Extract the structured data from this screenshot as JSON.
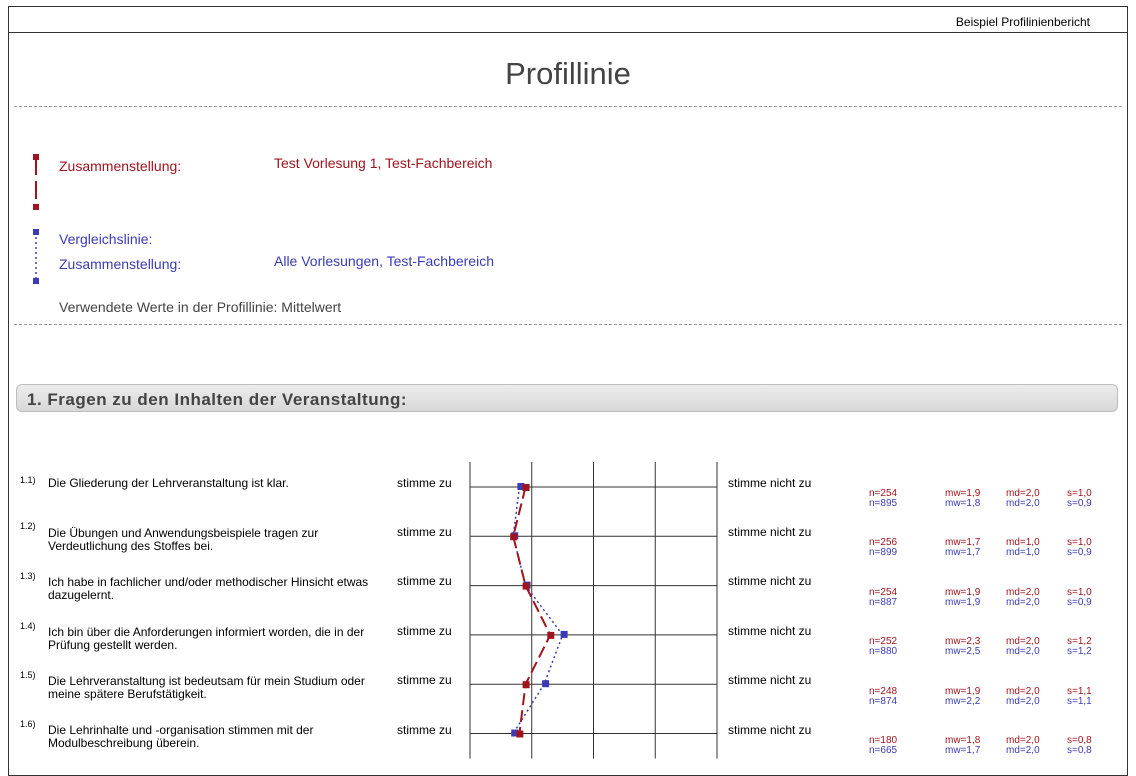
{
  "header": {
    "report_name": "Beispiel Profilinienbericht",
    "title": "Profillinie"
  },
  "legend": {
    "main_label": "Zusammenstellung:",
    "main_value": "Test Vorlesung 1, Test-Fachbereich",
    "compare_heading": "Vergleichslinie:",
    "compare_label": "Zusammenstellung:",
    "compare_value": "Alle Vorlesungen, Test-Fachbereich",
    "note": "Verwendete Werte in der Profillinie: Mittelwert"
  },
  "colors": {
    "main": "#a0141e",
    "compare": "#3b3bb4"
  },
  "section": {
    "title": "1. Fragen zu den Inhalten der Veranstaltung:"
  },
  "questions": [
    {
      "num": "1.1)",
      "text": "Die Gliederung der Lehrveranstaltung ist klar.",
      "left": "stimme zu",
      "right": "stimme nicht zu",
      "main": {
        "n": "n=254",
        "mw": "mw=1,9",
        "md": "md=2,0",
        "s": "s=1,0"
      },
      "compare": {
        "n": "n=895",
        "mw": "mw=1,8",
        "md": "md=2,0",
        "s": "s=0,9"
      }
    },
    {
      "num": "1.2)",
      "text": "Die Übungen und Anwendungsbeispiele tragen zur Verdeutlichung des Stoffes bei.",
      "left": "stimme zu",
      "right": "stimme nicht zu",
      "main": {
        "n": "n=256",
        "mw": "mw=1,7",
        "md": "md=1,0",
        "s": "s=1,0"
      },
      "compare": {
        "n": "n=899",
        "mw": "mw=1,7",
        "md": "md=1,0",
        "s": "s=0,9"
      }
    },
    {
      "num": "1.3)",
      "text": "Ich habe in fachlicher und/oder methodischer Hinsicht etwas dazugelernt.",
      "left": "stimme zu",
      "right": "stimme nicht zu",
      "main": {
        "n": "n=254",
        "mw": "mw=1,9",
        "md": "md=2,0",
        "s": "s=1,0"
      },
      "compare": {
        "n": "n=887",
        "mw": "mw=1,9",
        "md": "md=2,0",
        "s": "s=0,9"
      }
    },
    {
      "num": "1.4)",
      "text": "Ich bin über die Anforderungen informiert worden, die in der Prüfung gestellt werden.",
      "left": "stimme zu",
      "right": "stimme nicht zu",
      "main": {
        "n": "n=252",
        "mw": "mw=2,3",
        "md": "md=2,0",
        "s": "s=1,2"
      },
      "compare": {
        "n": "n=880",
        "mw": "mw=2,5",
        "md": "md=2,0",
        "s": "s=1,2"
      }
    },
    {
      "num": "1.5)",
      "text": "Die Lehrveranstaltung ist bedeutsam für mein Studium oder meine spätere Berufstätigkeit.",
      "left": "stimme zu",
      "right": "stimme nicht zu",
      "main": {
        "n": "n=248",
        "mw": "mw=1,9",
        "md": "md=2,0",
        "s": "s=1,1"
      },
      "compare": {
        "n": "n=874",
        "mw": "mw=2,2",
        "md": "md=2,0",
        "s": "s=1,1"
      }
    },
    {
      "num": "1.6)",
      "text": "Die Lehrinhalte und -organisation stimmen mit der Modulbeschreibung überein.",
      "left": "stimme zu",
      "right": "stimme nicht zu",
      "main": {
        "n": "n=180",
        "mw": "mw=1,8",
        "md": "md=2,0",
        "s": "s=0,8"
      },
      "compare": {
        "n": "n=665",
        "mw": "mw=1,7",
        "md": "md=2,0",
        "s": "s=0,8"
      }
    }
  ],
  "chart_data": {
    "type": "line",
    "scale": [
      1,
      5
    ],
    "categories": [
      "1.1)",
      "1.2)",
      "1.3)",
      "1.4)",
      "1.5)",
      "1.6)"
    ],
    "series": [
      {
        "values": [
          1.9,
          1.7,
          1.9,
          2.3,
          1.9,
          1.8
        ]
      },
      {
        "values": [
          1.8,
          1.7,
          1.9,
          2.5,
          2.2,
          1.7
        ]
      }
    ]
  }
}
